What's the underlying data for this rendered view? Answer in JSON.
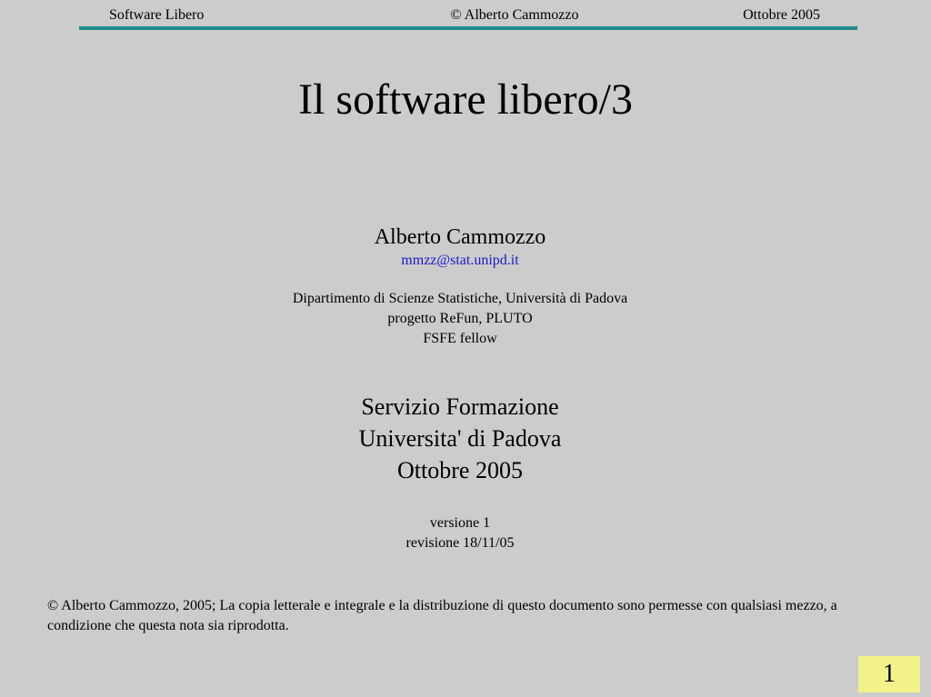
{
  "header": {
    "left": "Software Libero",
    "center": "© Alberto Cammozzo",
    "right": "Ottobre 2005"
  },
  "title": "Il software libero/3",
  "author": {
    "name": "Alberto Cammozzo",
    "email": "mmzz@stat.unipd.it",
    "affiliations": [
      "Dipartimento di Scienze Statistiche, Università di Padova",
      "progetto ReFun, PLUTO",
      "FSFE fellow"
    ]
  },
  "event": {
    "lines": [
      "Servizio Formazione",
      "Universita' di Padova",
      "Ottobre 2005"
    ]
  },
  "version": {
    "version_line": "versione 1",
    "revision_line": "revisione 18/11/05"
  },
  "copyright": "© Alberto Cammozzo, 2005; La copia letterale e integrale e la distribuzione di questo documento sono permesse con qualsiasi mezzo, a condizione che questa nota sia riprodotta.",
  "page_number": "1",
  "colors": {
    "background": "#cccccc",
    "header_rule": "#208a8a",
    "link": "#1a1acc",
    "page_badge": "#f2f28a"
  }
}
